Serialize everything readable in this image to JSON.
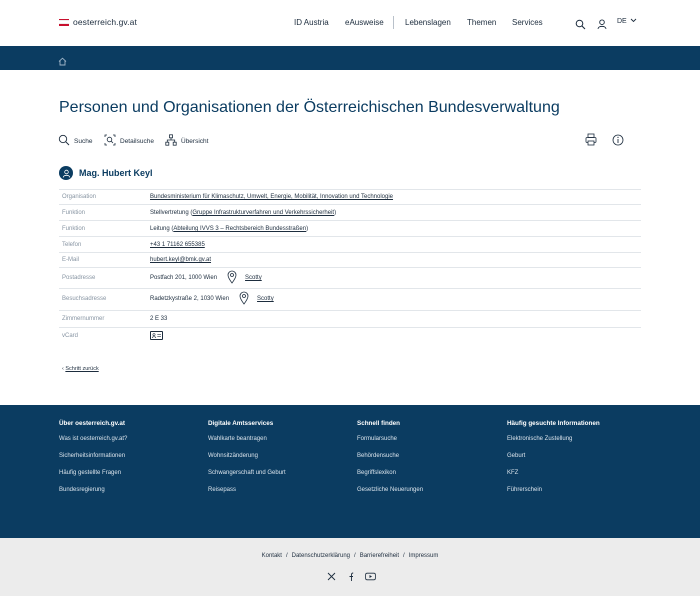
{
  "header": {
    "logo_text": "oesterreich.gv.at",
    "flag_colors": [
      "#c8102e",
      "#ffffff",
      "#c8102e"
    ],
    "nav": [
      "ID Austria",
      "eAusweise",
      "Lebenslagen",
      "Themen",
      "Services"
    ],
    "language": "DE"
  },
  "page": {
    "title": "Personen und Organisationen der Österreichischen Bundesverwaltung"
  },
  "tools": {
    "search": "Suche",
    "detail_search": "Detailsuche",
    "overview": "Übersicht"
  },
  "person": {
    "name": "Mag. Hubert Keyl"
  },
  "details": [
    {
      "label": "Organisation",
      "value": "Bundesministerium für Klimaschutz, Umwelt, Energie, Mobilität, Innovation und Technologie",
      "link": true
    },
    {
      "label": "Funktion",
      "value_pre": "Stellvertretung (",
      "value_link": "Gruppe Infrastrukturverfahren und Verkehrssicherheit",
      "value_post": ")"
    },
    {
      "label": "Funktion",
      "value_pre": "Leitung (",
      "value_link": "Abteilung IVVS 3 – Rechtsbereich Bundesstraßen",
      "value_post": ")"
    },
    {
      "label": "Telefon",
      "value": "+43 1 71162 655385",
      "link": true
    },
    {
      "label": "E-Mail",
      "value": "hubert.keyl@bmk.gv.at",
      "link": true
    },
    {
      "label": "Postadresse",
      "value": "Postfach 201, 1000 Wien",
      "map": "Scotty"
    },
    {
      "label": "Besuchsadresse",
      "value": "Radetzkystraße 2, 1030 Wien",
      "map": "Scotty"
    },
    {
      "label": "Zimmernummer",
      "value": "2 E 33"
    },
    {
      "label": "vCard",
      "value": ""
    }
  ],
  "back_link": "Schritt zurück",
  "footer": {
    "columns": [
      {
        "heading": "Über oesterreich.gv.at",
        "items": [
          "Was ist oesterreich.gv.at?",
          "Sicherheitsinformationen",
          "Häufig gestellte Fragen",
          "Bundesregierung"
        ]
      },
      {
        "heading": "Digitale Amtsservices",
        "items": [
          "Wahlkarte beantragen",
          "Wohnsitzänderung",
          "Schwangerschaft und Geburt",
          "Reisepass"
        ]
      },
      {
        "heading": "Schnell finden",
        "items": [
          "Formularsuche",
          "Behördensuche",
          "Begriffslexikon",
          "Gesetzliche Neuerungen"
        ]
      },
      {
        "heading": "Häufig gesuchte Informationen",
        "items": [
          "Elektronische Zustellung",
          "Geburt",
          "KFZ",
          "Führerschein"
        ]
      }
    ],
    "sublinks": [
      "Kontakt",
      "Datenschutzerklärung",
      "Barrierefreiheit",
      "Impressum"
    ],
    "separator": "/",
    "social_icons": [
      "x-icon",
      "facebook-icon",
      "youtube-icon"
    ]
  },
  "colors": {
    "brand_blue": "#0b3c61",
    "subfooter_bg": "#ececec"
  }
}
